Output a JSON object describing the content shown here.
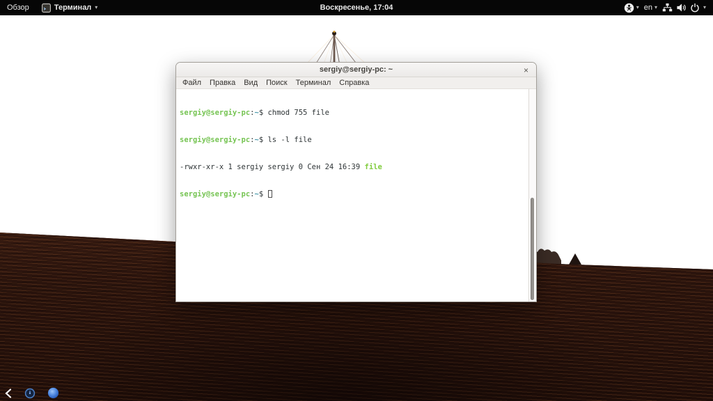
{
  "topbar": {
    "activities_label": "Обзор",
    "app_menu_label": "Терминал",
    "clock": "Воскресенье, 17:04",
    "language_indicator": "en",
    "dropdown_arrow": "▾",
    "icons": [
      "terminal-icon",
      "accessibility-icon",
      "network-wired-icon",
      "volume-icon",
      "power-icon"
    ]
  },
  "window": {
    "title": "sergiy@sergiy-pc: ~",
    "close_label": "×",
    "menus": [
      "Файл",
      "Правка",
      "Вид",
      "Поиск",
      "Терминал",
      "Справка"
    ]
  },
  "terminal": {
    "lines": [
      {
        "user": "sergiy@sergiy-pc",
        "colon": ":",
        "path": "~",
        "prompt_symbol": "$ ",
        "command": "chmod 755 file"
      },
      {
        "user": "sergiy@sergiy-pc",
        "colon": ":",
        "path": "~",
        "prompt_symbol": "$ ",
        "command": "ls -l file"
      },
      {
        "output": "-rwxr-xr-x 1 sergiy sergiy 0 Сен 24 16:39 ",
        "file": "file"
      },
      {
        "user": "sergiy@sergiy-pc",
        "colon": ":",
        "path": "~",
        "prompt_symbol": "$ "
      }
    ]
  },
  "colors": {
    "topbar_bg": "#060606",
    "terminal_bg": "#ffffff",
    "terminal_fg": "#2e3436",
    "prompt_green": "#76c453",
    "path_blue": "#4596a8",
    "executable_green": "#82cc3f",
    "titlebar_bg": "#f2f1ef"
  }
}
